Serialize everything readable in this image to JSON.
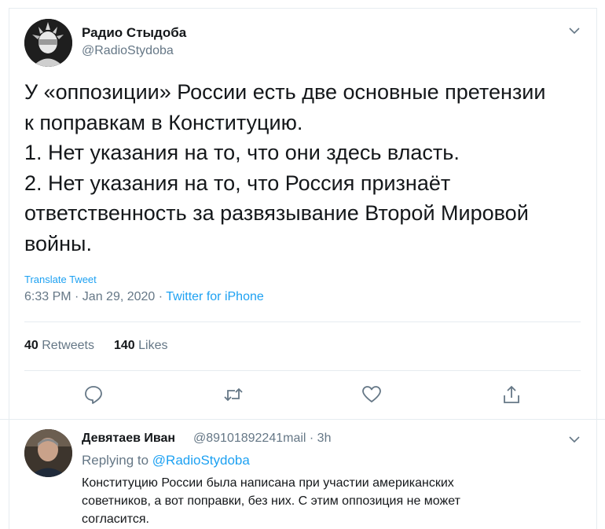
{
  "tweet": {
    "author_name": "Радио Стыдоба",
    "author_handle": "@RadioStydoba",
    "text_lines": [
      "У «оппозиции» России есть две основные претензии",
      "к поправкам в Конституцию.",
      "1. Нет указания на то, что они здесь власть.",
      "2. Нет указания на то, что Россия признаёт",
      "ответственность за развязывание Второй Мировой",
      "войны."
    ],
    "translate_label": "Translate Tweet",
    "time": "6:33 PM · Jan 29, 2020 · ",
    "source": "Twitter for iPhone",
    "retweets_count": "40",
    "retweets_label": "Retweets",
    "likes_count": "140",
    "likes_label": "Likes"
  },
  "actions": {
    "icons": [
      "reply-icon",
      "retweet-icon",
      "like-icon",
      "share-icon"
    ]
  },
  "reply": {
    "author_name": "Девятаев Иван",
    "author_handle": "@89101892241mail · 3h",
    "replying_prefix": "Replying to ",
    "replying_to": "@RadioStydoba",
    "text_lines": [
      "Конституцию России была написана при участии американских",
      "советников, а вот поправки, без них. С этим оппозиция не может",
      "согласится."
    ]
  },
  "colors": {
    "accent": "#1da1f2",
    "secondary_text": "#657786",
    "primary_text": "#14171a",
    "divider": "#e6ecf0"
  }
}
